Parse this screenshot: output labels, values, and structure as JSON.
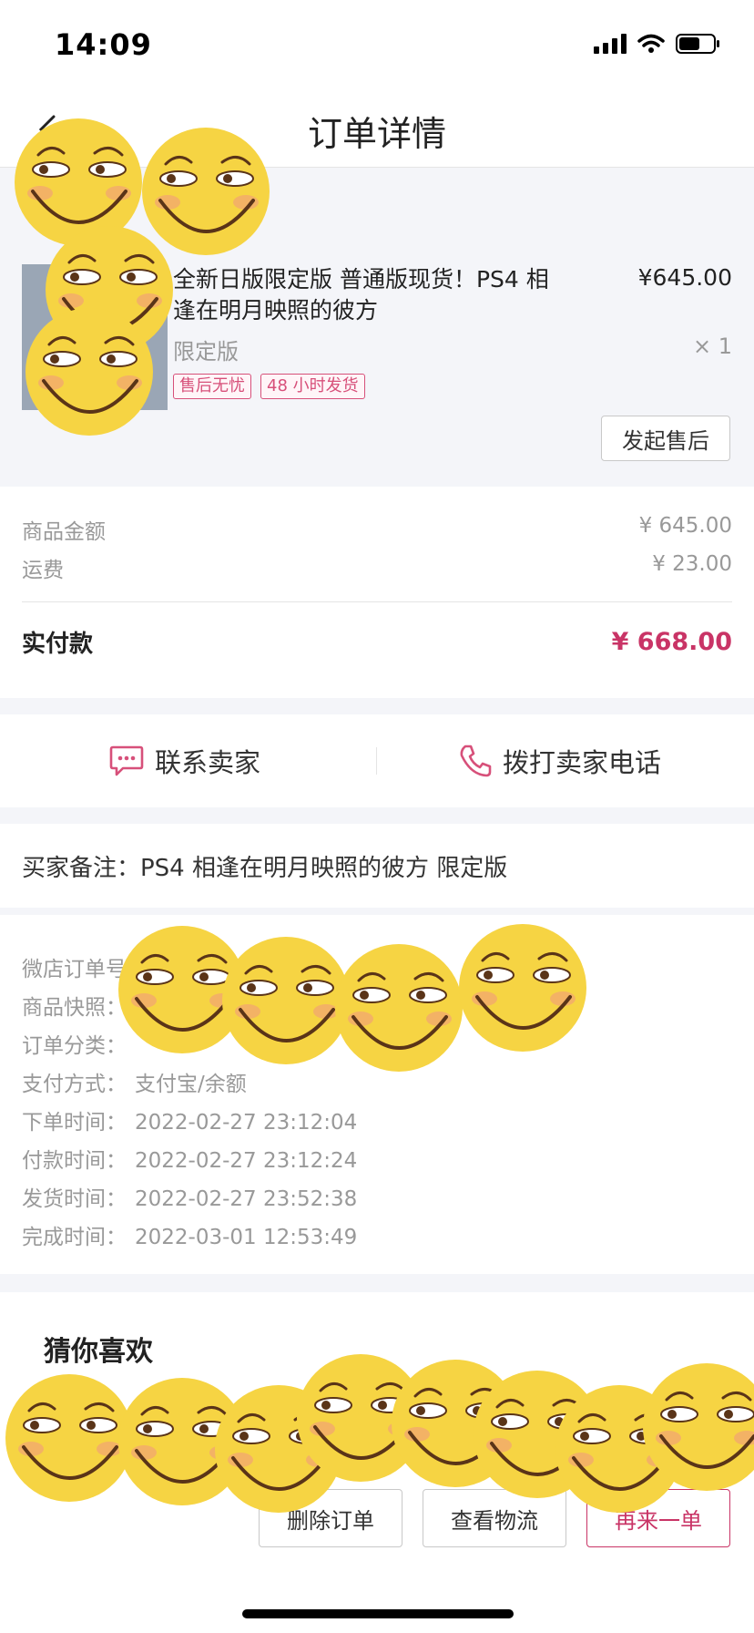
{
  "status_bar": {
    "time": "14:09"
  },
  "nav": {
    "title": "订单详情"
  },
  "product": {
    "title": "全新日版限定版 普通版现货！PS4 相逢在明月映照的彼方",
    "price": "¥645.00",
    "spec": "限定版",
    "qty": "× 1",
    "tags": [
      "售后无忧",
      "48 小时发货"
    ],
    "aftersale_label": "发起售后"
  },
  "amounts": {
    "goods_label": "商品金额",
    "goods_value": "¥ 645.00",
    "shipping_label": "运费",
    "shipping_value": "¥ 23.00",
    "paid_label": "实付款",
    "paid_value": "¥ 668.00"
  },
  "contact": {
    "seller_label": "联系卖家",
    "phone_label": "拨打卖家电话"
  },
  "remark": {
    "text": "买家备注：PS4 相逢在明月映照的彼方 限定版"
  },
  "order_info": [
    {
      "label": "微店订单号",
      "value": ""
    },
    {
      "label": "商品快照：",
      "value": ""
    },
    {
      "label": "订单分类：",
      "value": ""
    },
    {
      "label": "支付方式：",
      "value": "支付宝/余额"
    },
    {
      "label": "下单时间：",
      "value": "2022-02-27 23:12:04"
    },
    {
      "label": "付款时间：",
      "value": "2022-02-27 23:12:24"
    },
    {
      "label": "发货时间：",
      "value": "2022-02-27 23:52:38"
    },
    {
      "label": "完成时间：",
      "value": "2022-03-01 12:53:49"
    }
  ],
  "recommend": {
    "title": "猜你喜欢"
  },
  "bottom_bar": {
    "delete_label": "删除订单",
    "logistics_label": "查看物流",
    "reorder_label": "再来一单"
  },
  "colors": {
    "accent": "#c93466",
    "sticker": "#f6d443"
  },
  "icons": [
    "back-arrow-icon",
    "signal-icon",
    "wifi-icon",
    "battery-icon",
    "chat-bubble-icon",
    "phone-icon",
    "smiley-sticker-icon"
  ]
}
